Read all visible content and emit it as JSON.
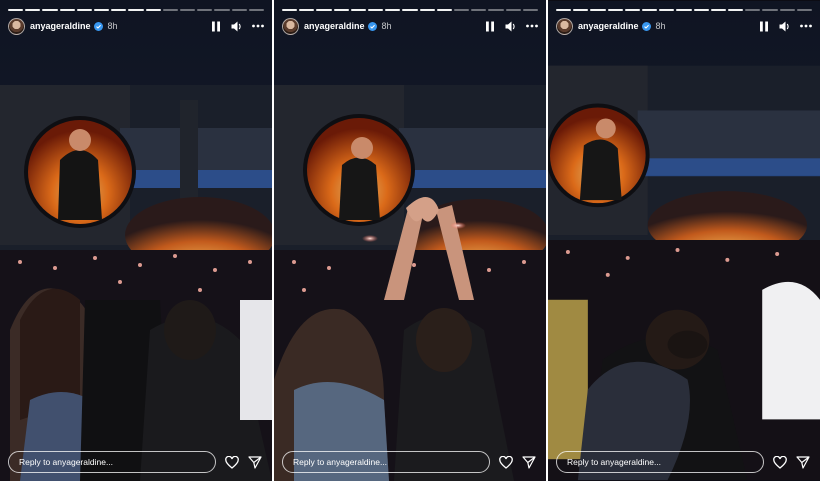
{
  "stories": [
    {
      "username": "anyageraldine",
      "time": "8h",
      "reply_placeholder": "Reply to anyageraldine...",
      "progress_done": 9,
      "progress_total": 15
    },
    {
      "username": "anyageraldine",
      "time": "8h",
      "reply_placeholder": "Reply to anyageraldine...",
      "progress_done": 10,
      "progress_total": 15
    },
    {
      "username": "anyageraldine",
      "time": "8h",
      "reply_placeholder": "Reply to anyageraldine...",
      "progress_done": 11,
      "progress_total": 15
    }
  ],
  "icons": {
    "pause": "pause-icon",
    "volume": "volume-icon",
    "more": "more-icon",
    "like": "heart-icon",
    "share": "send-icon",
    "verified": "verified-badge-icon"
  },
  "colors": {
    "text": "#ffffff",
    "verified": "#3897f0",
    "stage_fire": "#ff7a1a",
    "wristband_glow": "#ffb3a6"
  }
}
